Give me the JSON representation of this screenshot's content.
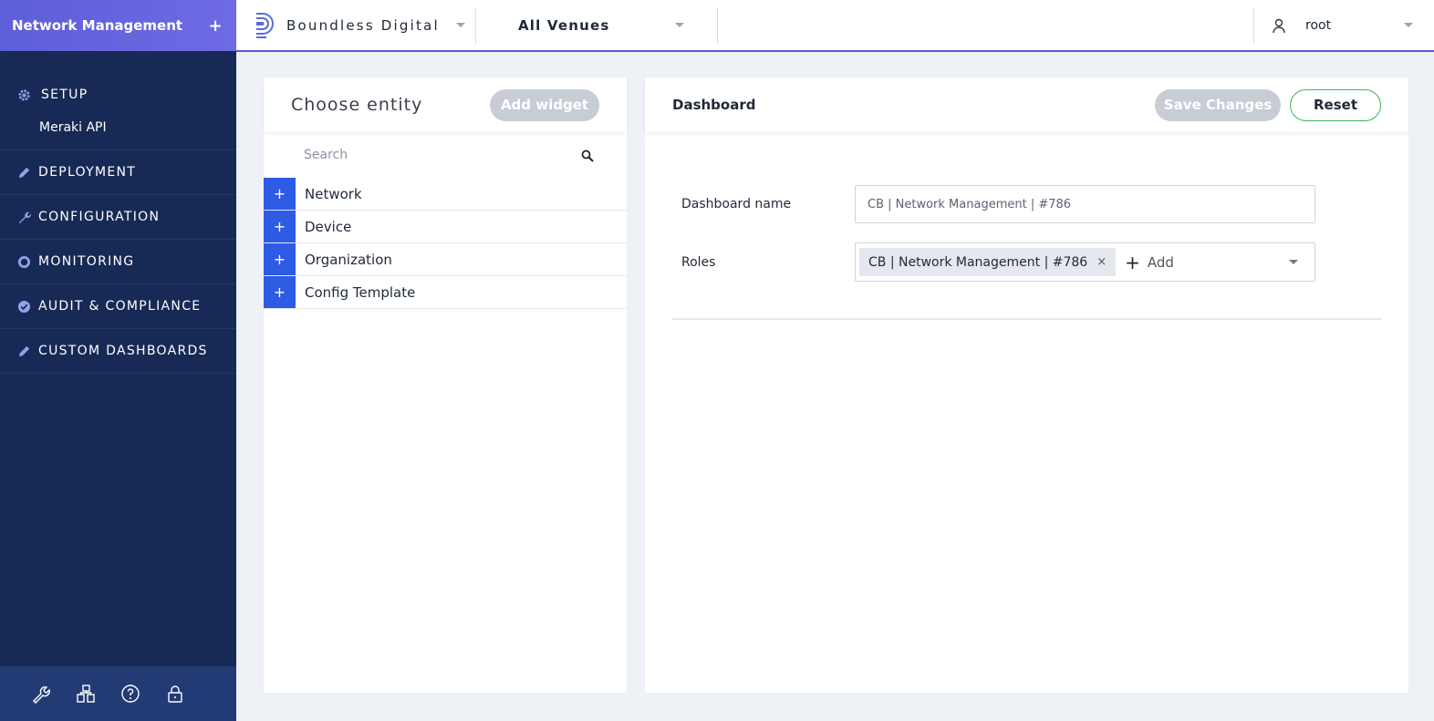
{
  "sidebar": {
    "app_title": "Network Management",
    "add_label": "+",
    "sections": [
      {
        "label": "SETUP",
        "icon": "gear-icon",
        "sub": [
          "Meraki API"
        ]
      },
      {
        "label": "DEPLOYMENT",
        "icon": "pencil-icon"
      },
      {
        "label": "CONFIGURATION",
        "icon": "wrench-icon"
      },
      {
        "label": "MONITORING",
        "icon": "monitoring-icon"
      },
      {
        "label": "AUDIT & COMPLIANCE",
        "icon": "check-circle-icon"
      },
      {
        "label": "CUSTOM DASHBOARDS",
        "icon": "pencil-icon"
      }
    ],
    "footer_icons": [
      "wrench-icon",
      "org-chart-icon",
      "help-icon",
      "lock-icon"
    ]
  },
  "topbar": {
    "org_name": "Boundless Digital",
    "venue": "All Venues",
    "user": "root"
  },
  "left_panel": {
    "title": "Choose entity",
    "add_widget": "Add widget",
    "search_placeholder": "Search",
    "entities": [
      {
        "label": "Network"
      },
      {
        "label": "Device"
      },
      {
        "label": "Organization"
      },
      {
        "label": "Config Template"
      }
    ],
    "plus": "+"
  },
  "right_panel": {
    "title": "Dashboard",
    "save": "Save Changes",
    "reset": "Reset",
    "name_label": "Dashboard name",
    "name_value": "CB | Network Management | #786",
    "roles_label": "Roles",
    "role_chip": "CB | Network Management | #786",
    "role_remove": "×",
    "add_label": "Add"
  }
}
